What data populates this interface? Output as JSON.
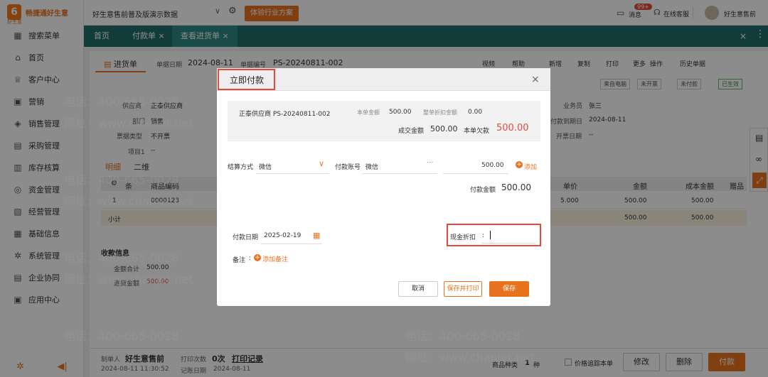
{
  "app": {
    "logo_text": "畅捷通好生意",
    "logo_sub": "好生意"
  },
  "sidebar": {
    "items": [
      {
        "label": "搜索菜单",
        "icon": "grid-icon"
      },
      {
        "label": "首页",
        "icon": "home-icon"
      },
      {
        "label": "客户中心",
        "icon": "trophy-icon"
      },
      {
        "label": "营销",
        "icon": "gift-icon"
      },
      {
        "label": "销售管理",
        "icon": "tag-icon"
      },
      {
        "label": "采购管理",
        "icon": "cart-icon"
      },
      {
        "label": "库存核算",
        "icon": "warehouse-icon"
      },
      {
        "label": "资金管理",
        "icon": "coin-icon"
      },
      {
        "label": "经营管理",
        "icon": "clipboard-icon"
      },
      {
        "label": "基础信息",
        "icon": "table-icon"
      },
      {
        "label": "系统管理",
        "icon": "cog-icon"
      },
      {
        "label": "企业协同",
        "icon": "document-icon"
      },
      {
        "label": "应用中心",
        "icon": "apps-icon"
      }
    ]
  },
  "topbar": {
    "title": "好生意售前普及版演示数据",
    "experience_button": "体验行业方案",
    "messages_label": "消息",
    "messages_badge": "99+",
    "support_label": "在线客服",
    "user_name": "好生意售前"
  },
  "tabs": [
    {
      "label": "首页"
    },
    {
      "label": "付款单"
    },
    {
      "label": "查看进货单"
    }
  ],
  "doc": {
    "tab_label": "进货单",
    "date_label": "单据日期",
    "date_value": "2024-08-11",
    "code_label": "单据编号",
    "code_value": "PS-20240811-002",
    "toolbar": [
      "视频",
      "帮助",
      "新增",
      "复制",
      "打印",
      "更多",
      "操作",
      "历史单据"
    ],
    "status_tags": [
      "来自电脑",
      "未开票",
      "未付款",
      "已生效"
    ],
    "supplier_label": "供应商",
    "supplier_value": "正泰供应商",
    "dept_label": "部门",
    "dept_value": "销售",
    "invoice_label": "票据类型",
    "invoice_value": "不开票",
    "item1_label": "项目1",
    "item1_value": "--",
    "salesman_label": "业务员",
    "salesman_value": "张三",
    "due_label": "付款到期日",
    "due_value": "2024-08-11",
    "invoice_date_label": "开票日期",
    "invoice_date_value": "--",
    "subtabs": [
      "明细",
      "二维"
    ],
    "table_headers": [
      "条",
      "商品编码",
      "单价",
      "金额",
      "成本金额",
      "赠品"
    ],
    "row": {
      "index": "1",
      "code": "0000123",
      "price": "5.000",
      "amount": "500.00",
      "cost": "500.00"
    },
    "subtotal_label": "小计",
    "subtotal_amount": "500.00",
    "subtotal_cost": "500.00",
    "collect_title": "收款信息",
    "total_label": "金额合计",
    "total_value": "500.00",
    "purchase_label": "进货金额",
    "purchase_value": "500.00"
  },
  "footer": {
    "maker_label": "制单人",
    "maker_value": "好生意售前",
    "maker_time": "2024-08-11 11:30:52",
    "print_count_label": "打印次数",
    "print_count_value": "0次",
    "print_record": "打印记录",
    "post_date_label": "记账日期",
    "post_date_value": "2024-08-11",
    "kinds_label": "商品种类",
    "kinds_value": "1",
    "kinds_unit": "种",
    "track_label": "价格追踪本单",
    "btn_edit": "修改",
    "btn_delete": "删除",
    "btn_pay": "付款"
  },
  "dialog": {
    "title": "立即付款",
    "supplier_doc": "正泰供应商 PS-20240811-002",
    "doc_amount_label": "本单金额",
    "doc_amount_value": "500.00",
    "discount_label": "整单折扣金额",
    "discount_value": "0.00",
    "deal_label": "成交金额",
    "deal_value": "500.00",
    "owed_label": "本单欠款",
    "owed_value": "500.00",
    "settle_label": "结算方式",
    "settle_value": "微信",
    "account_label": "付款账号",
    "account_value": "微信",
    "amount_value": "500.00",
    "add_label": "添加",
    "pay_amount_label": "付款金额",
    "pay_amount_value": "500.00",
    "pay_date_label": "付款日期",
    "pay_date_value": "2025-02-19",
    "cash_discount_label": "现金折扣",
    "note_label": "备注",
    "add_note_label": "添加备注",
    "btn_cancel": "取消",
    "btn_save_print": "保存并打印",
    "btn_save": "保存"
  },
  "watermark": {
    "phone": "电话：400-665-0028",
    "site": "网址：www.chanjet.net"
  },
  "colors": {
    "accent": "#e8731f",
    "teal": "#1f6e6b",
    "red": "#e24b3b"
  }
}
